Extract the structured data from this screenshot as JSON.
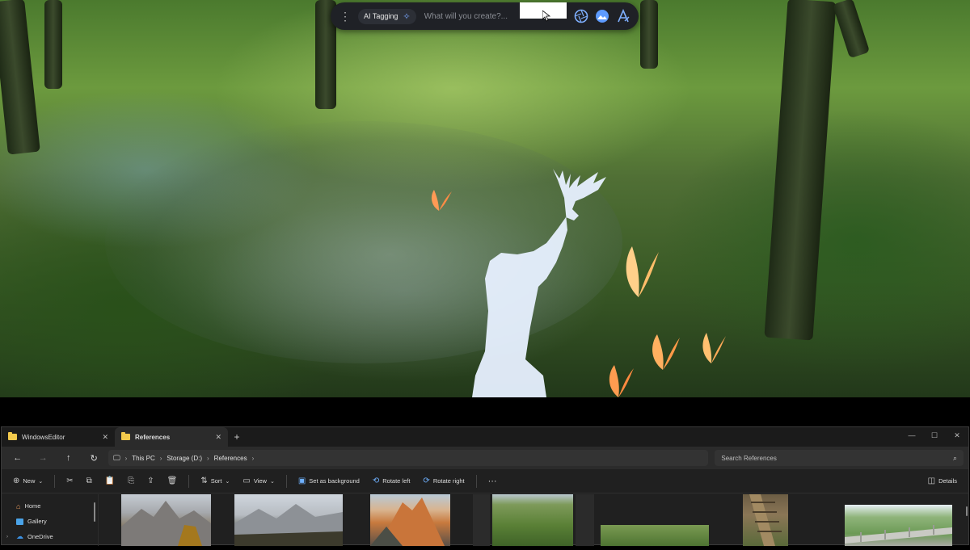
{
  "float_toolbar": {
    "menu_icon": "more-vertical-icon",
    "ai_tagging_label": "AI Tagging",
    "prompt_placeholder": "What will you create?...",
    "tools": [
      "aperture-icon",
      "image-icon",
      "text-style-icon"
    ]
  },
  "explorer": {
    "tabs": [
      {
        "label": "WindowsEditor",
        "active": false
      },
      {
        "label": "References",
        "active": true
      }
    ],
    "new_tab": "+",
    "window_controls": [
      "—",
      "☐",
      "✕"
    ],
    "breadcrumbs": [
      "This PC",
      "Storage (D:)",
      "References"
    ],
    "search_placeholder": "Search References",
    "commands": {
      "new": "New",
      "sort": "Sort",
      "view": "View",
      "set_background": "Set as background",
      "rotate_left": "Rotate left",
      "rotate_right": "Rotate right",
      "more": "···",
      "details": "Details"
    },
    "nav_items": [
      {
        "label": "Home",
        "icon": "home-icon"
      },
      {
        "label": "Gallery",
        "icon": "gallery-icon"
      },
      {
        "label": "OneDrive",
        "icon": "onedrive-icon"
      }
    ]
  }
}
